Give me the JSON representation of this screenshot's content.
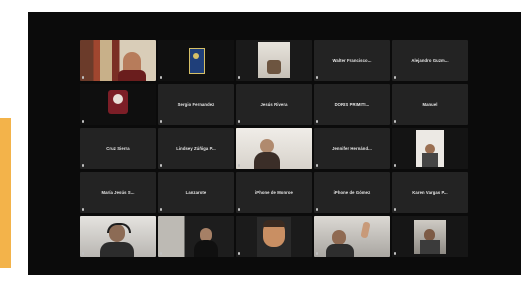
{
  "meeting": {
    "participants": [
      {
        "id": "p1",
        "name": "",
        "video": "bookshelf"
      },
      {
        "id": "p2",
        "name": "",
        "video": "logo"
      },
      {
        "id": "p3",
        "name": "",
        "video": "room"
      },
      {
        "id": "p4",
        "name": "Walter Francisco...",
        "video": "none"
      },
      {
        "id": "p5",
        "name": "Alejandro Guzm...",
        "video": "none"
      },
      {
        "id": "p6",
        "name": "",
        "video": "avatar"
      },
      {
        "id": "p7",
        "name": "Sergio Fernandez",
        "video": "none"
      },
      {
        "id": "p8",
        "name": "Jesús Rivera",
        "video": "none"
      },
      {
        "id": "p9",
        "name": "DORIS PRIMITI...",
        "video": "none"
      },
      {
        "id": "p10",
        "name": "Manuel",
        "video": "none"
      },
      {
        "id": "p11",
        "name": "Cruz Sierra",
        "video": "none"
      },
      {
        "id": "p12",
        "name": "Lindsey Zúñiga P...",
        "video": "none"
      },
      {
        "id": "p13",
        "name": "",
        "video": "woman-light-room"
      },
      {
        "id": "p14",
        "name": "Jennifer Hernánd...",
        "video": "none"
      },
      {
        "id": "p15",
        "name": "",
        "video": "person-wall"
      },
      {
        "id": "p16",
        "name": "María Jesús S...",
        "video": "none"
      },
      {
        "id": "p17",
        "name": "Lanzarote",
        "video": "none"
      },
      {
        "id": "p18",
        "name": "iPhone de Monroe",
        "video": "none"
      },
      {
        "id": "p19",
        "name": "iPhone de Gómez",
        "video": "none"
      },
      {
        "id": "p20",
        "name": "Karen Vargas P...",
        "video": "none"
      },
      {
        "id": "p21",
        "name": "",
        "video": "man-headset"
      },
      {
        "id": "p22",
        "name": "",
        "video": "woman-dark"
      },
      {
        "id": "p23",
        "name": "",
        "video": "man-face"
      },
      {
        "id": "p24",
        "name": "",
        "video": "man-raised-hand"
      },
      {
        "id": "p25",
        "name": "",
        "video": "person-room"
      }
    ]
  },
  "colors": {
    "accent": "#f3b34a",
    "window_bg": "#0b0b0b",
    "tile_bg": "#232323",
    "active_speaker": "#f1d04b"
  }
}
